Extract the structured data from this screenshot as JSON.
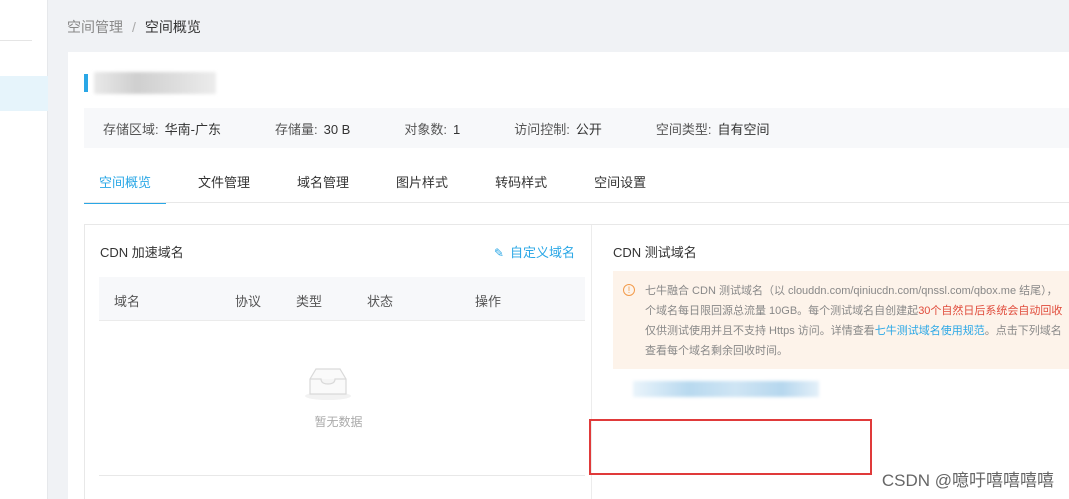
{
  "breadcrumb": {
    "parent": "空间管理",
    "separator": "/",
    "current": "空间概览"
  },
  "info": {
    "region_label": "存储区域:",
    "region_value": "华南-广东",
    "storage_label": "存储量:",
    "storage_value": "30 B",
    "objects_label": "对象数:",
    "objects_value": "1",
    "access_label": "访问控制:",
    "access_value": "公开",
    "type_label": "空间类型:",
    "type_value": "自有空间"
  },
  "tabs": [
    "空间概览",
    "文件管理",
    "域名管理",
    "图片样式",
    "转码样式",
    "空间设置"
  ],
  "cdn_domain": {
    "title": "CDN 加速域名",
    "custom_link": "自定义域名",
    "columns": [
      "域名",
      "协议",
      "类型",
      "状态",
      "操作"
    ],
    "empty_text": "暂无数据"
  },
  "test_domain": {
    "title": "CDN 测试域名",
    "notice": {
      "line1": "七牛融合 CDN 测试域名（以 clouddn.com/qiniucdn.com/qnssl.com/qbox.me 结尾），",
      "line2_a": "个域名每日限回源总流量 10GB。每个测试域名自创建起",
      "line2_red": "30个自然日后系统会自动回收",
      "line3_a": "仅供测试使用并且不支持 Https 访问。详情查看",
      "line3_link": "七牛测试域名使用规范",
      "line3_b": "。点击下列域名",
      "line4": "查看每个域名剩余回收时间。"
    }
  },
  "watermark": "CSDN @噫吁嘻嘻嘻嘻",
  "colors": {
    "accent": "#2aa7e6",
    "warning": "#f29b4b",
    "highlight_box": "#e03a3a"
  }
}
